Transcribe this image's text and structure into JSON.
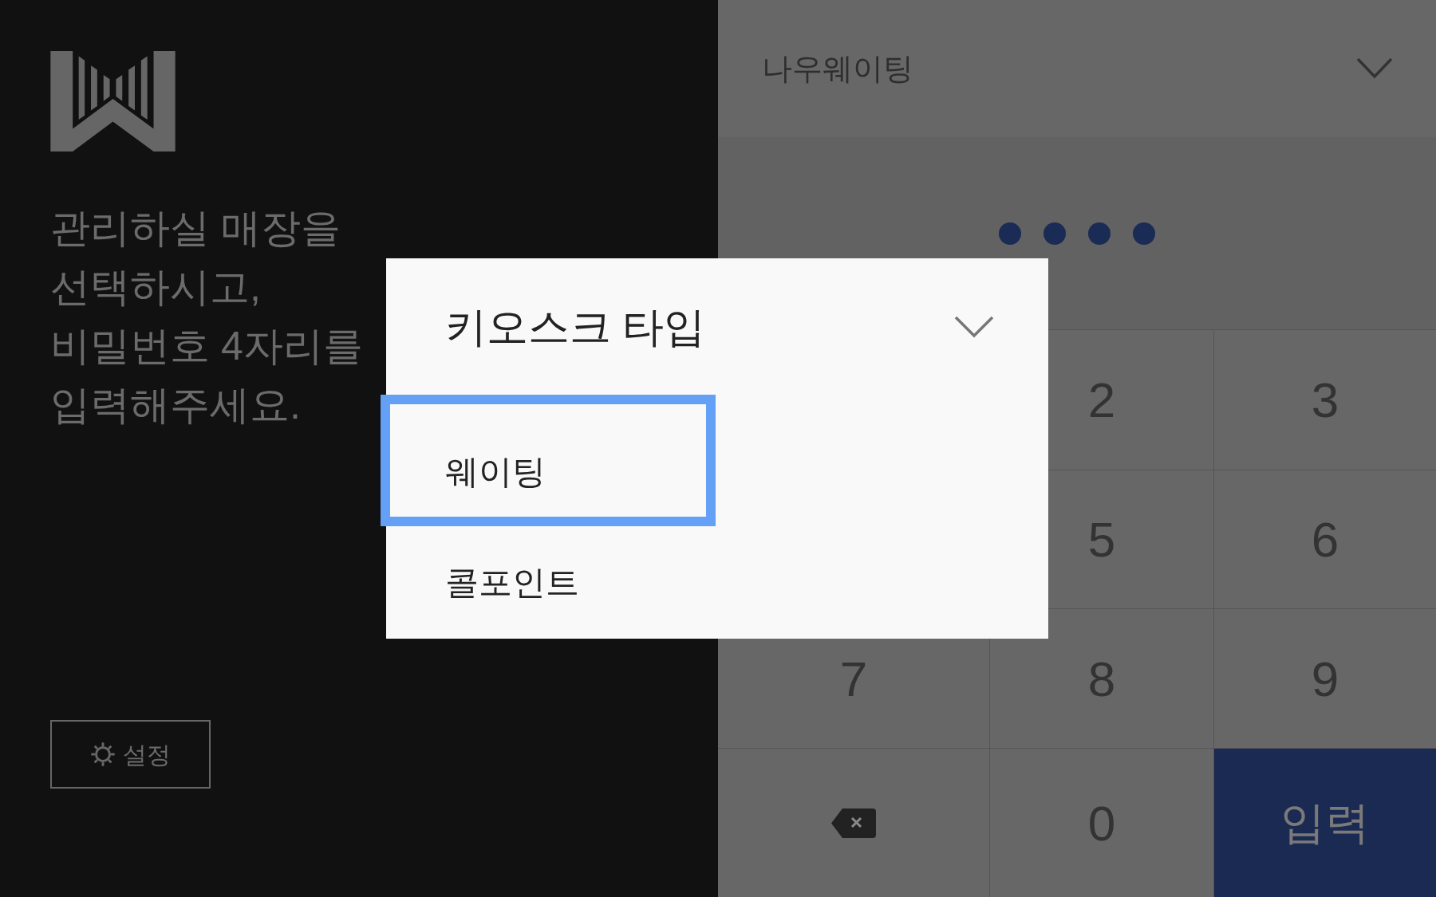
{
  "sidebar": {
    "message_lines": [
      "관리하실 매장을",
      "선택하시고,",
      "비밀번호 4자리를",
      "입력해주세요."
    ],
    "settings_button": {
      "label": "설정"
    }
  },
  "store_select": {
    "value": "나우웨이팅"
  },
  "pin_dots": [
    {
      "filled": true
    },
    {
      "filled": true
    },
    {
      "filled": true
    },
    {
      "filled": true
    }
  ],
  "keypad": {
    "keys": [
      {
        "kind": "covered"
      },
      {
        "kind": "digit",
        "label": "2"
      },
      {
        "kind": "digit",
        "label": "3"
      },
      {
        "kind": "covered"
      },
      {
        "kind": "digit",
        "label": "5"
      },
      {
        "kind": "digit",
        "label": "6"
      },
      {
        "kind": "digit",
        "label": "7"
      },
      {
        "kind": "digit",
        "label": "8"
      },
      {
        "kind": "digit",
        "label": "9"
      },
      {
        "kind": "backspace"
      },
      {
        "kind": "digit",
        "label": "0"
      },
      {
        "kind": "submit",
        "label": "입력"
      }
    ]
  },
  "dialog": {
    "title": "키오스크 타입",
    "options": [
      {
        "label": "웨이팅",
        "selected": true
      },
      {
        "label": "콜포인트",
        "selected": false
      }
    ]
  }
}
